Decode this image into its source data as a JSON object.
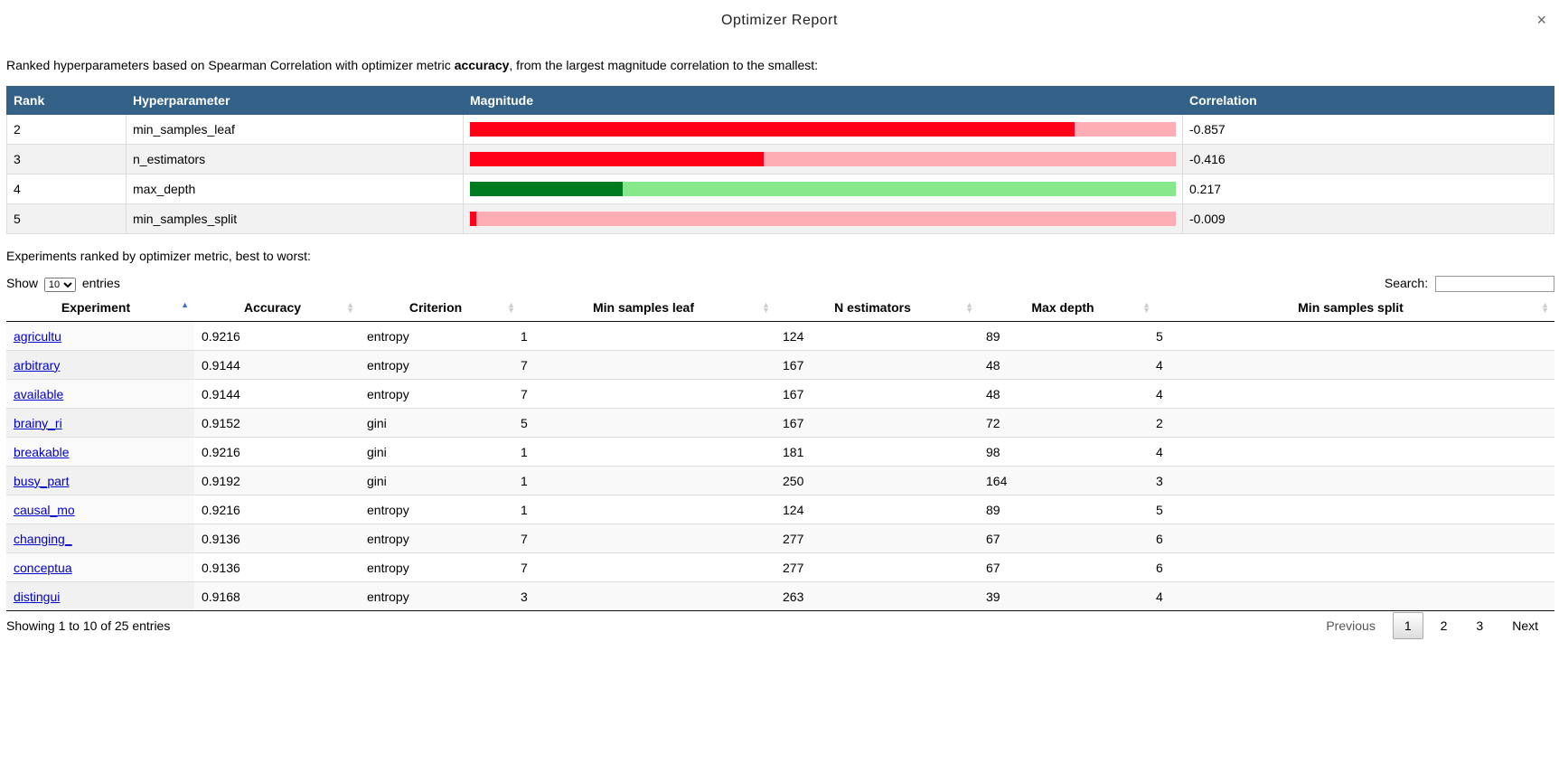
{
  "dialog": {
    "title": "Optimizer Report",
    "close_icon": "×"
  },
  "intro": {
    "prefix": "Ranked hyperparameters based on Spearman Correlation with optimizer metric ",
    "metric": "accuracy",
    "suffix": ", from the largest magnitude correlation to the smallest:"
  },
  "hp_table": {
    "headers": [
      "Rank",
      "Hyperparameter",
      "Magnitude",
      "Correlation"
    ],
    "colors": {
      "neg_fill": "#ff0018",
      "neg_track": "#ffadb5",
      "pos_fill": "#007a1f",
      "pos_track": "#86e88a"
    },
    "rows": [
      {
        "rank": "2",
        "name": "min_samples_leaf",
        "magnitude": 0.857,
        "sign": "neg",
        "corr": "-0.857"
      },
      {
        "rank": "3",
        "name": "n_estimators",
        "magnitude": 0.416,
        "sign": "neg",
        "corr": "-0.416"
      },
      {
        "rank": "4",
        "name": "max_depth",
        "magnitude": 0.217,
        "sign": "pos",
        "corr": "0.217"
      },
      {
        "rank": "5",
        "name": "min_samples_split",
        "magnitude": 0.009,
        "sign": "neg",
        "corr": "-0.009"
      }
    ]
  },
  "experiments": {
    "label": "Experiments ranked by optimizer metric, best to worst:",
    "show_prefix": "Show",
    "show_value": "10",
    "show_suffix": "entries",
    "search_label": "Search:",
    "headers": [
      "Experiment",
      "Accuracy",
      "Criterion",
      "Min samples leaf",
      "N estimators",
      "Max depth",
      "Min samples split"
    ],
    "rows": [
      [
        "agricultu",
        "0.9216",
        "entropy",
        "1",
        "124",
        "89",
        "5"
      ],
      [
        "arbitrary",
        "0.9144",
        "entropy",
        "7",
        "167",
        "48",
        "4"
      ],
      [
        "available",
        "0.9144",
        "entropy",
        "7",
        "167",
        "48",
        "4"
      ],
      [
        "brainy_ri",
        "0.9152",
        "gini",
        "5",
        "167",
        "72",
        "2"
      ],
      [
        "breakable",
        "0.9216",
        "gini",
        "1",
        "181",
        "98",
        "4"
      ],
      [
        "busy_part",
        "0.9192",
        "gini",
        "1",
        "250",
        "164",
        "3"
      ],
      [
        "causal_mo",
        "0.9216",
        "entropy",
        "1",
        "124",
        "89",
        "5"
      ],
      [
        "changing_",
        "0.9136",
        "entropy",
        "7",
        "277",
        "67",
        "6"
      ],
      [
        "conceptua",
        "0.9136",
        "entropy",
        "7",
        "277",
        "67",
        "6"
      ],
      [
        "distingui",
        "0.9168",
        "entropy",
        "3",
        "263",
        "39",
        "4"
      ]
    ],
    "info": "Showing 1 to 10 of 25 entries",
    "pager": {
      "previous": "Previous",
      "pages": [
        "1",
        "2",
        "3"
      ],
      "current": "1",
      "next": "Next"
    }
  }
}
